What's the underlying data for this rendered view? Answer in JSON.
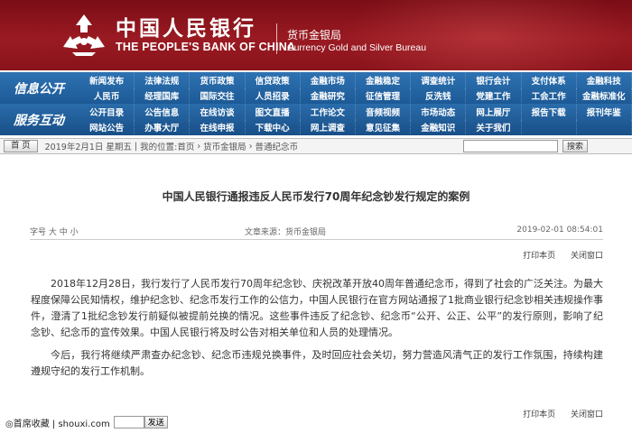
{
  "header": {
    "bank_name_cn": "中国人民银行",
    "bank_name_en": "THE PEOPLE'S BANK OF CHINA",
    "bureau_cn": "货币金银局",
    "bureau_en": "Currency  Gold and Silver Bureau"
  },
  "nav": {
    "row1": {
      "label": "信息公开",
      "items": [
        "新闻发布",
        "法律法规",
        "货币政策",
        "信贷政策",
        "金融市场",
        "金融稳定",
        "调查统计",
        "银行会计",
        "支付体系",
        "金融科技",
        "人民币",
        "经理国库",
        "国际交往",
        "人员招录",
        "金融研究",
        "征信管理",
        "反洗钱",
        "党建工作",
        "工会工作",
        "金融标准化"
      ]
    },
    "row2": {
      "label": "服务互动",
      "items": [
        "公开目录",
        "公告信息",
        "在线访谈",
        "图文直播",
        "工作论文",
        "音频视频",
        "市场动态",
        "网上展厅",
        "报告下载",
        "报刊年鉴",
        "网站公告",
        "办事大厅",
        "在线申报",
        "下载中心",
        "网上调查",
        "意见征集",
        "金融知识",
        "关于我们",
        "",
        ""
      ]
    }
  },
  "infobar": {
    "home_label": "首 页",
    "date": "2019年2月1日 星期五",
    "location_label": "我的位置:",
    "crumb_home": "首页",
    "crumb_section": "货币金银局",
    "crumb_page": "普通纪念币",
    "search_placeholder": "",
    "search_button": "搜索"
  },
  "article": {
    "title": "中国人民银行通报违反人民币发行70周年纪念钞发行规定的案例",
    "font_size_label": "字号",
    "size_large": "大",
    "size_medium": "中",
    "size_small": "小",
    "source": "文章来源：货币金银局",
    "pub_date": "2019-02-01  08:54:01",
    "print_label": "打印本页",
    "close_label": "关闭窗口",
    "paragraphs": [
      "2018年12月28日，我行发行了人民币发行70周年纪念钞、庆祝改革开放40周年普通纪念币，得到了社会的广泛关注。为最大程度保障公民知情权，维护纪念钞、纪念币发行工作的公信力，中国人民银行在官方网站通报了1批商业银行纪念钞相关违规操作事件，澄清了1批纪念钞发行前疑似被提前兑换的情况。这些事件违反了纪念钞、纪念币“公开、公正、公平”的发行原则，影响了纪念钞、纪念币的宣传效果。中国人民银行将及时公告对相关单位和人员的处理情况。",
      "今后，我行将继续严肃查办纪念钞、纪念币违规兑换事件，及时回应社会关切，努力营造风清气正的发行工作氛围，持续构建遵规守纪的发行工作机制。"
    ]
  },
  "bookmark": {
    "label": "◎首席收藏 | shouxi.com",
    "button": "发送"
  }
}
